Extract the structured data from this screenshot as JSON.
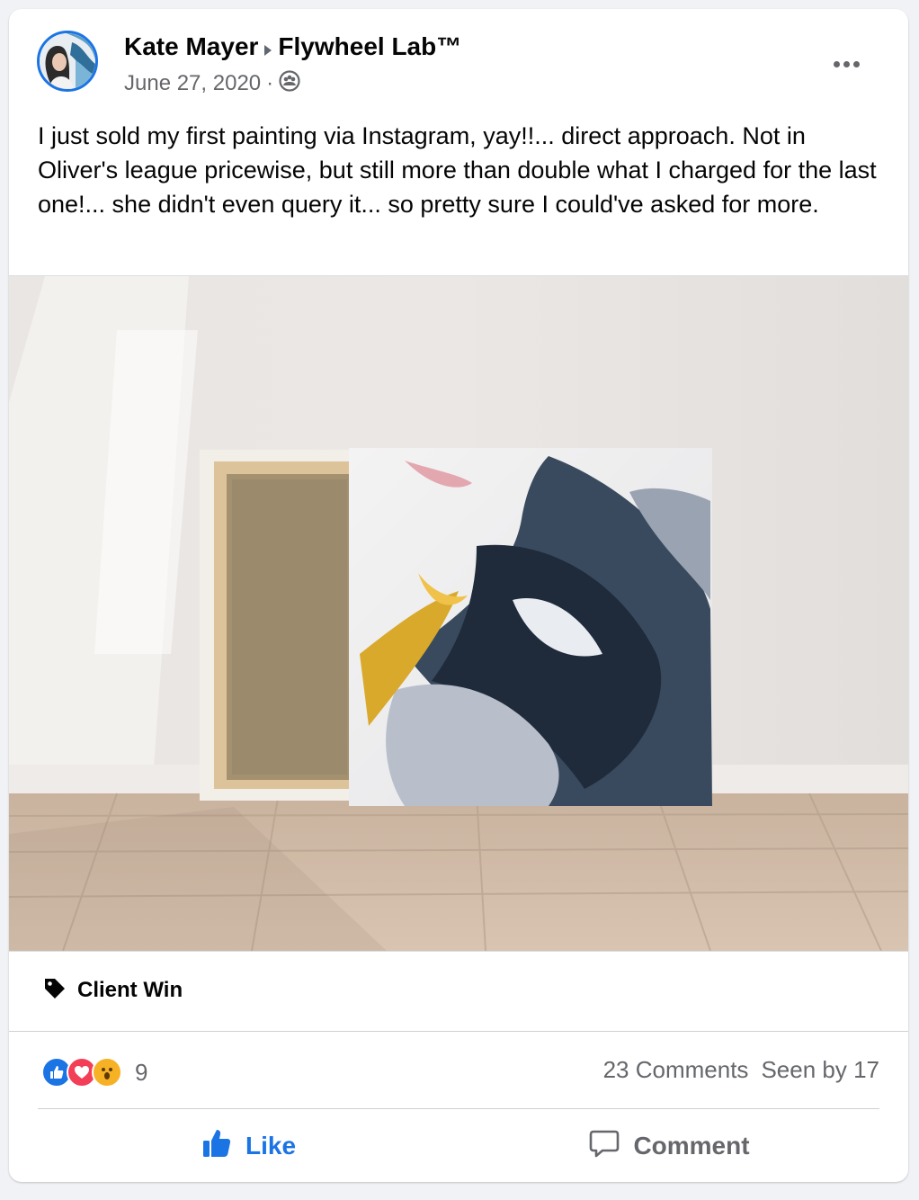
{
  "post": {
    "author": "Kate Mayer",
    "group": "Flywheel Lab™",
    "date": "June 27, 2020",
    "separator": "·",
    "audience_icon": "group-icon",
    "menu_icon": "more-options-icon",
    "text": "I just sold my first painting via Instagram, yay!!... direct approach. Not in Oliver's league pricewise, but still more than double what I charged for the last one!... she didn't even query it... so pretty sure I could've asked for more.",
    "topic_tag": "Client Win",
    "topic_icon": "tag-icon"
  },
  "engagement": {
    "reaction_icons": [
      "like-reaction-icon",
      "love-reaction-icon",
      "wow-reaction-icon"
    ],
    "reaction_count": "9",
    "comments": "23 Comments",
    "seen_by": "Seen by 17"
  },
  "actions": {
    "like_label": "Like",
    "comment_label": "Comment"
  },
  "colors": {
    "accent": "#1b74e4",
    "secondary_text": "#65676b",
    "primary_text": "#050505",
    "love": "#f33e58",
    "wow": "#f7b125"
  }
}
